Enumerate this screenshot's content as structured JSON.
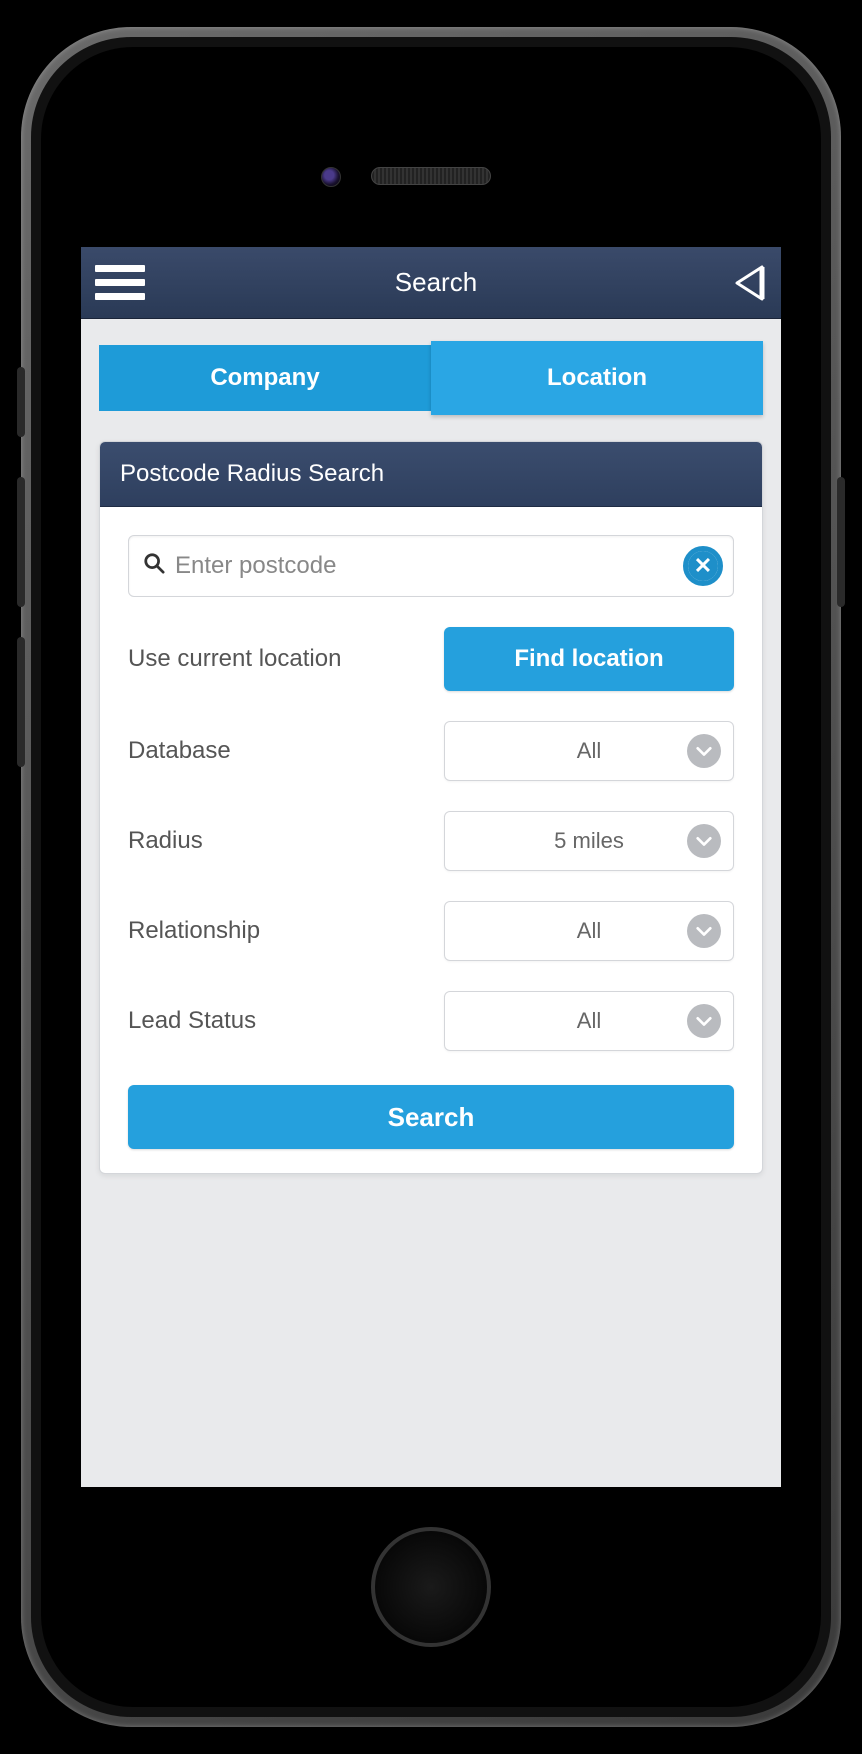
{
  "header": {
    "title": "Search"
  },
  "tabs": {
    "company": "Company",
    "location": "Location"
  },
  "card": {
    "title": "Postcode Radius Search"
  },
  "search": {
    "placeholder": "Enter postcode"
  },
  "location_row": {
    "label": "Use current location",
    "button": "Find location"
  },
  "fields": {
    "database": {
      "label": "Database",
      "value": "All"
    },
    "radius": {
      "label": "Radius",
      "value": "5 miles"
    },
    "relationship": {
      "label": "Relationship",
      "value": "All"
    },
    "lead_status": {
      "label": "Lead Status",
      "value": "All"
    }
  },
  "buttons": {
    "search": "Search"
  }
}
